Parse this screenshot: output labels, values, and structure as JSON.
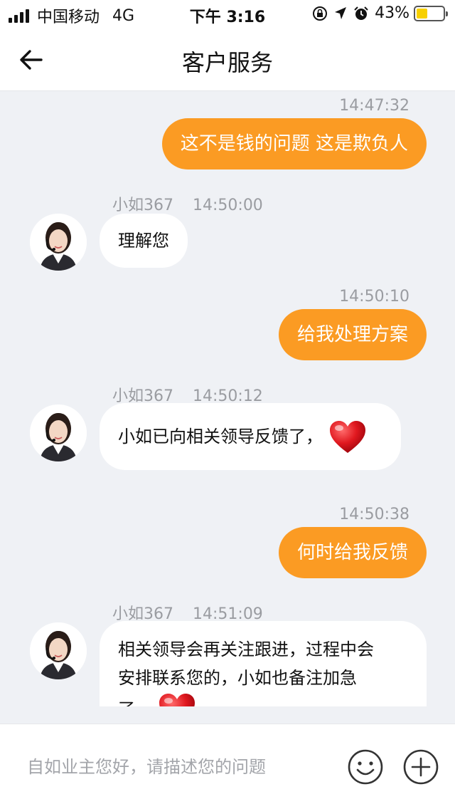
{
  "status_bar": {
    "carrier": "中国移动",
    "network": "4G",
    "time": "下午 3:16",
    "battery": "43%",
    "battery_level": 0.43,
    "battery_color": "#f7d000"
  },
  "header": {
    "title": "客户服务",
    "back_icon": "arrow-left-icon"
  },
  "colors": {
    "outgoing_bubble": "#fb9b23",
    "incoming_bubble": "#ffffff",
    "background": "#eff1f5"
  },
  "messages": [
    {
      "direction": "out",
      "time": "14:47:32",
      "text": "这不是钱的问题 这是欺负人"
    },
    {
      "direction": "in",
      "agent": "小如367",
      "time": "14:50:00",
      "text": "理解您"
    },
    {
      "direction": "out",
      "time": "14:50:10",
      "text": "给我处理方案"
    },
    {
      "direction": "in",
      "agent": "小如367",
      "time": "14:50:12",
      "text": "小如已向相关领导反馈了，",
      "emoji": "heart-icon"
    },
    {
      "direction": "out",
      "time": "14:50:38",
      "text": "何时给我反馈"
    },
    {
      "direction": "in",
      "agent": "小如367",
      "time": "14:51:09",
      "lines": [
        "相关领导会再关注跟进，过程中会",
        "安排联系您的，小如也备注加急",
        "了，"
      ],
      "emoji": "heart-icon"
    }
  ],
  "input": {
    "placeholder": "自如业主您好，请描述您的问题",
    "emoji_icon": "smiley-icon",
    "add_icon": "plus-circle-icon"
  }
}
